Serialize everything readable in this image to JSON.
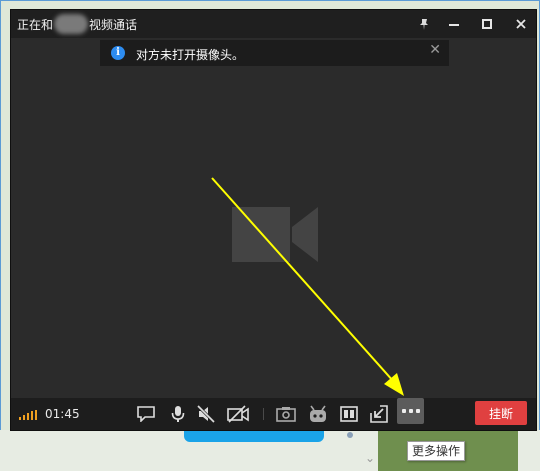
{
  "window": {
    "title_prefix": "正在和",
    "title_suffix": "视频通话",
    "controls": {
      "pin_icon": "pin-icon",
      "minimize_icon": "minimize-icon",
      "maximize_icon": "maximize-icon",
      "close_icon": "close-icon"
    }
  },
  "notice": {
    "icon": "info-icon",
    "icon_glyph": "i",
    "text": "对方未打开摄像头。",
    "close_glyph": "✕"
  },
  "toolbar": {
    "duration": "01:45",
    "buttons": [
      {
        "name": "chat-icon"
      },
      {
        "name": "microphone-icon"
      },
      {
        "name": "speaker-muted-icon"
      },
      {
        "name": "camera-off-icon"
      },
      {
        "name": "screenshot-icon"
      },
      {
        "name": "robot-icon"
      },
      {
        "name": "layout-icon"
      },
      {
        "name": "minimize-to-window-icon"
      },
      {
        "name": "more-icon"
      }
    ],
    "hangup_label": "挂断"
  },
  "tooltip": {
    "text": "更多操作"
  },
  "colors": {
    "hangup": "#e04040",
    "notice_icon": "#2d8cf0",
    "arrow": "#ffff00",
    "signal": "#f0a020"
  }
}
